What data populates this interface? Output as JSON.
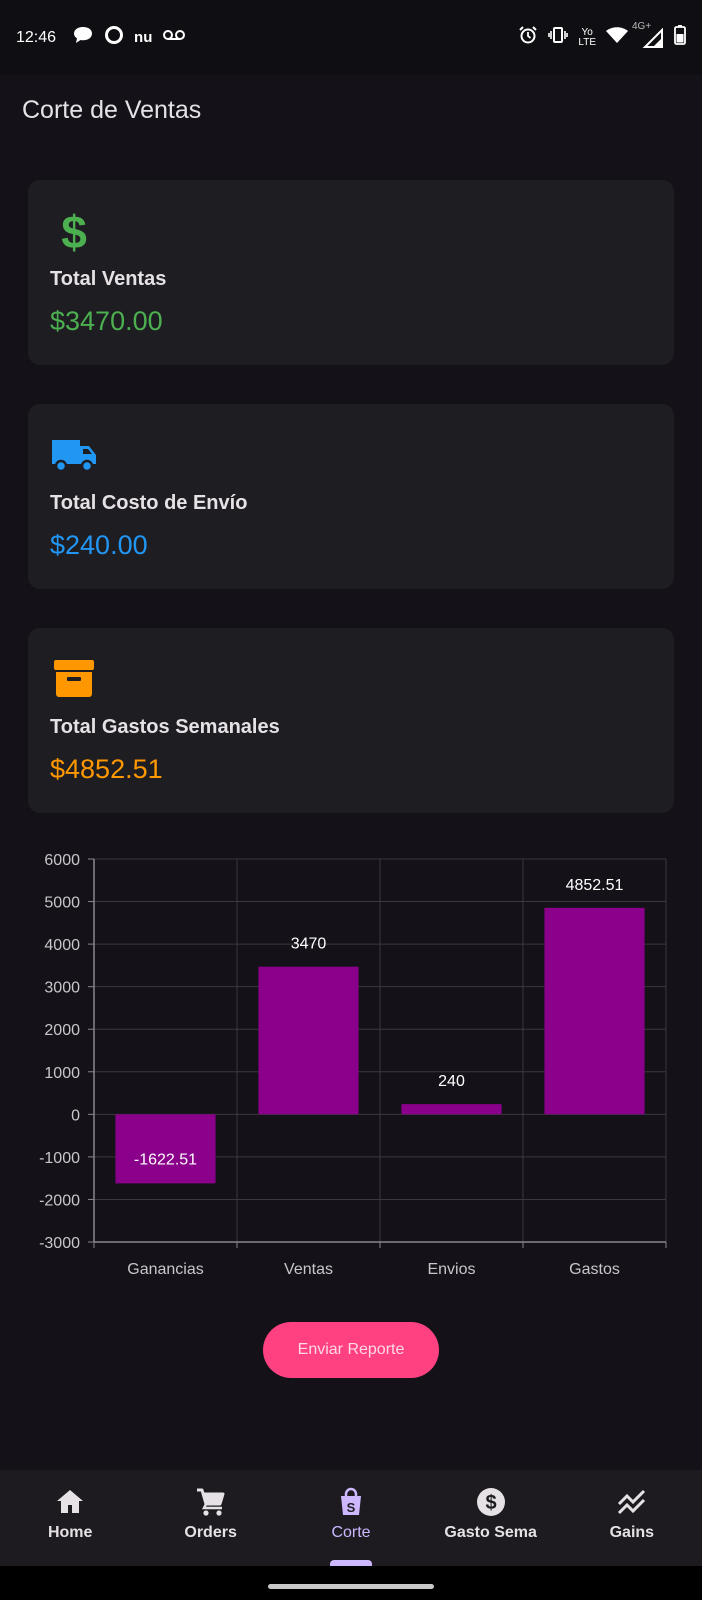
{
  "status_bar": {
    "time": "12:46",
    "left_icons": [
      "chat-bubble-icon",
      "circle-app-icon",
      "nu-app-icon",
      "voicemail-icon"
    ],
    "nu_text": "nu",
    "right_icons": [
      "alarm-icon",
      "vibrate-icon",
      "volte-icon",
      "wifi-icon",
      "signal-icon",
      "battery-icon"
    ],
    "volte_top": "Yo",
    "volte_bottom": "LTE",
    "network": "4G+"
  },
  "page": {
    "title": "Corte de Ventas"
  },
  "cards": [
    {
      "icon": "dollar-icon",
      "label": "Total Ventas",
      "value": "$3470.00",
      "color": "#4caf50"
    },
    {
      "icon": "truck-icon",
      "label": "Total Costo de Envío",
      "value": "$240.00",
      "color": "#2196f3"
    },
    {
      "icon": "archive-box-icon",
      "label": "Total Gastos Semanales",
      "value": "$4852.51",
      "color": "#ff9800"
    }
  ],
  "chart_data": {
    "type": "bar",
    "categories": [
      "Ganancias",
      "Ventas",
      "Envios",
      "Gastos"
    ],
    "values": [
      -1622.51,
      3470,
      240,
      4852.51
    ],
    "value_labels": [
      "-1622.51",
      "3470",
      "240",
      "4852.51"
    ],
    "ylim": [
      -3000,
      6000
    ],
    "yticks": [
      6000,
      5000,
      4000,
      3000,
      2000,
      1000,
      0,
      -1000,
      -2000,
      -3000
    ],
    "bar_color": "#8b008b",
    "grid": true
  },
  "actions": {
    "report_label": "Enviar Reporte"
  },
  "bottom_nav": {
    "items": [
      {
        "label": "Home",
        "icon": "home-icon"
      },
      {
        "label": "Orders",
        "icon": "cart-icon"
      },
      {
        "label": "Corte",
        "icon": "shopping-bag-icon"
      },
      {
        "label": "Gasto Semanal",
        "icon": "dollar-circle-icon"
      },
      {
        "label": "Gains",
        "icon": "trending-icon"
      }
    ],
    "active_index": 2,
    "active_color": "#cdb8ff"
  }
}
